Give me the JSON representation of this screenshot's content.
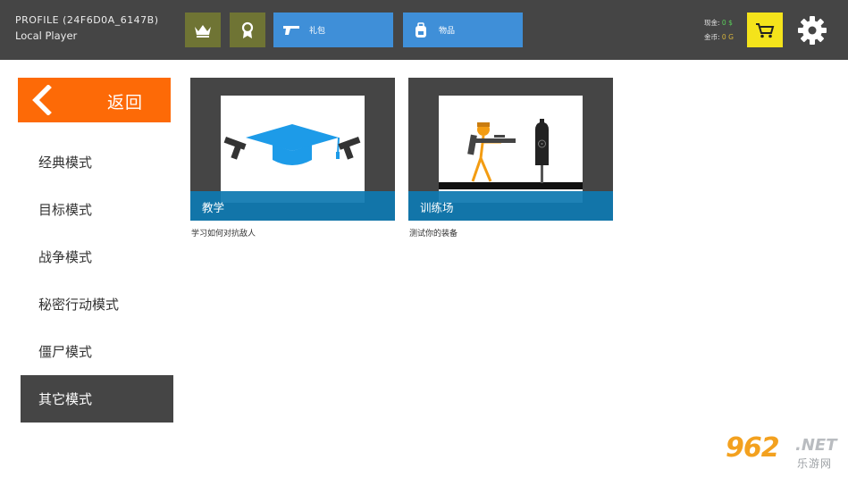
{
  "header": {
    "profile_id": "PROFILE (24F6D0A_6147B)",
    "player_name": "Local Player",
    "buttons": [
      {
        "icon": "crown-icon"
      },
      {
        "icon": "medal-icon"
      },
      {
        "icon": "pistol-icon",
        "label": "礼包"
      },
      {
        "icon": "backpack-icon",
        "label": "物品"
      }
    ],
    "currency": {
      "cash_label": "现金:",
      "cash_value": "0 $",
      "gold_label": "金币:",
      "gold_value": "0 G"
    },
    "cart_icon": "shopping-cart-icon",
    "settings_icon": "gear-icon"
  },
  "sidebar": {
    "back_label": "返回",
    "modes": [
      {
        "label": "经典模式",
        "active": false
      },
      {
        "label": "目标模式",
        "active": false
      },
      {
        "label": "战争模式",
        "active": false
      },
      {
        "label": "秘密行动模式",
        "active": false
      },
      {
        "label": "僵尸模式",
        "active": false
      },
      {
        "label": "其它模式",
        "active": true
      }
    ]
  },
  "cards": [
    {
      "title": "教学",
      "description": "学习如何对抗敌人",
      "image": "graduation-cap-with-pistols"
    },
    {
      "title": "训练场",
      "description": "测试你的装备",
      "image": "stickman-shooting-target"
    }
  ],
  "watermark": {
    "number": "962",
    "suffix": ".NET",
    "chinese": "乐游网"
  },
  "colors": {
    "topbar": "#454545",
    "olive_button": "#6f7434",
    "blue_button": "#3f8fd8",
    "cart_button": "#f4e31b",
    "back_button": "#fd6a07",
    "active_mode": "#454545",
    "card_title_bar": "#0e78b0"
  }
}
